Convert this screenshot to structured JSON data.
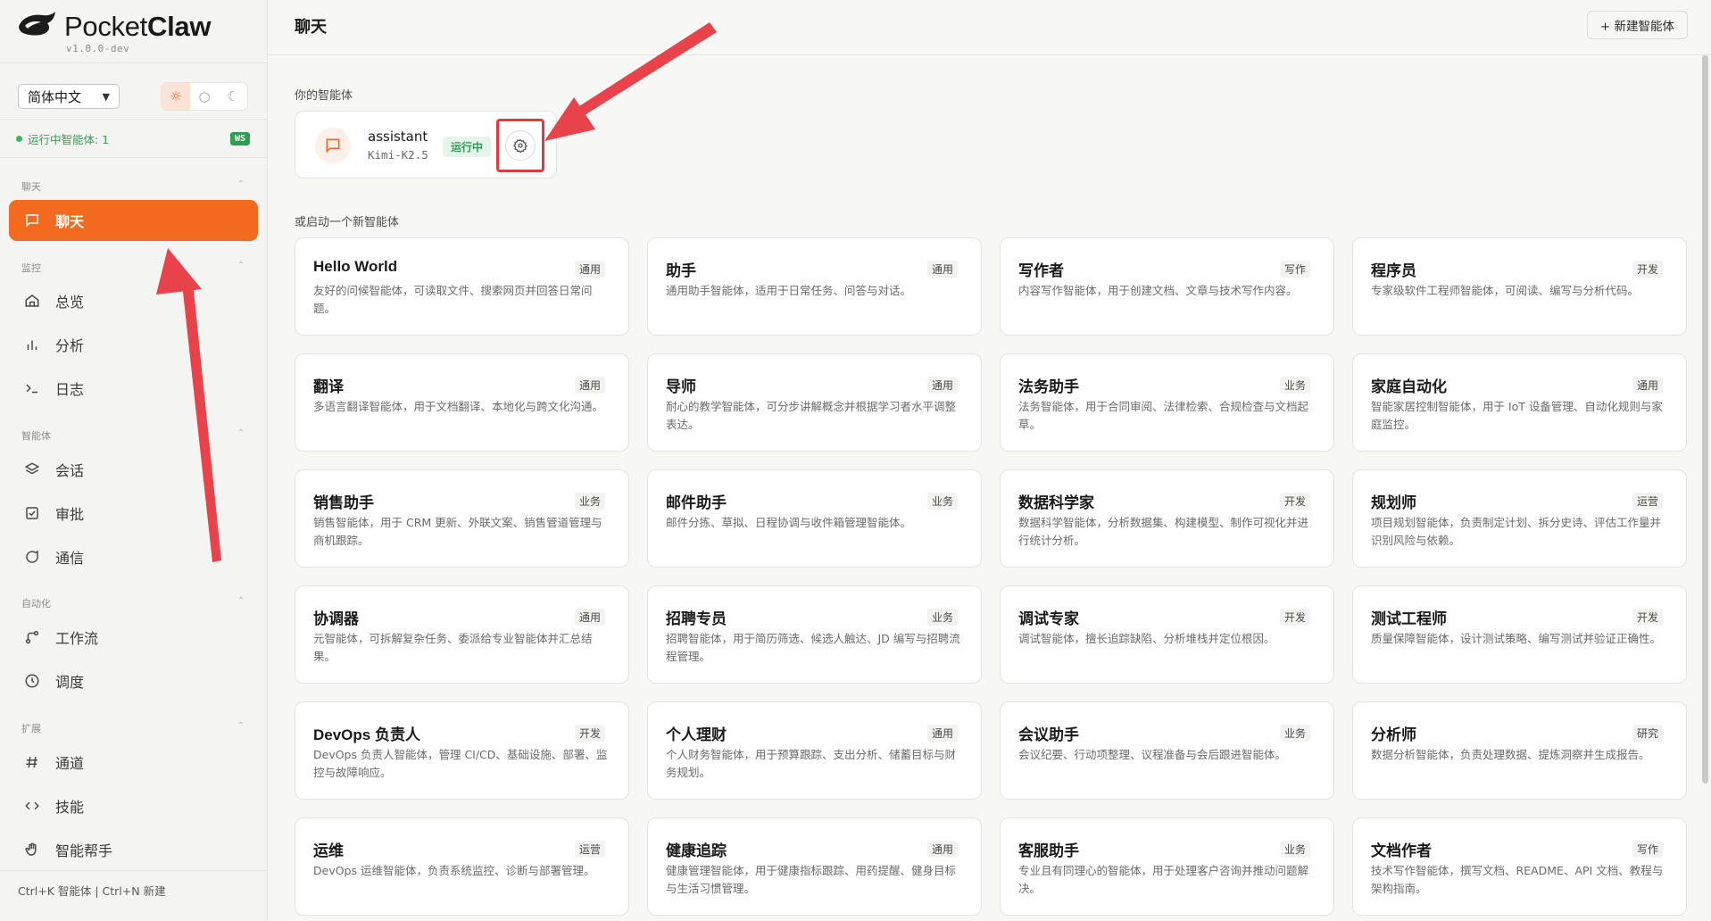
{
  "brand": {
    "name_light": "Pocket",
    "name_bold": "Claw",
    "version": "v1.0.0-dev"
  },
  "language": {
    "selected": "简体中文"
  },
  "theme": {
    "options": [
      "☼",
      "○",
      "☾"
    ],
    "active": "light"
  },
  "status": {
    "running_text": "运行中智能体: 1",
    "ws_badge": "WS"
  },
  "sidebar": {
    "sections": [
      {
        "label": "聊天",
        "items": [
          {
            "label": "聊天",
            "icon": "message-icon",
            "active": true
          }
        ]
      },
      {
        "label": "监控",
        "items": [
          {
            "label": "总览",
            "icon": "home-icon"
          },
          {
            "label": "分析",
            "icon": "bar-chart-icon"
          },
          {
            "label": "日志",
            "icon": "terminal-icon"
          }
        ]
      },
      {
        "label": "智能体",
        "items": [
          {
            "label": "会话",
            "icon": "layers-icon"
          },
          {
            "label": "审批",
            "icon": "checkbox-icon"
          },
          {
            "label": "通信",
            "icon": "chat-bubble-icon"
          }
        ]
      },
      {
        "label": "自动化",
        "items": [
          {
            "label": "工作流",
            "icon": "workflow-icon"
          },
          {
            "label": "调度",
            "icon": "clock-icon"
          }
        ]
      },
      {
        "label": "扩展",
        "items": [
          {
            "label": "通道",
            "icon": "hash-icon"
          },
          {
            "label": "技能",
            "icon": "code-icon"
          },
          {
            "label": "智能帮手",
            "icon": "hand-icon"
          }
        ]
      }
    ],
    "footer": "Ctrl+K 智能体 | Ctrl+N 新建"
  },
  "header": {
    "title": "聊天",
    "new_agent_label": "+ 新建智能体"
  },
  "my_agents": {
    "label": "你的智能体",
    "items": [
      {
        "name": "assistant",
        "model": "Kimi-K2.5",
        "status": "运行中"
      }
    ]
  },
  "templates": {
    "label": "或启动一个新智能体",
    "items": [
      {
        "name": "Hello World",
        "category": "通用",
        "desc": "友好的问候智能体，可读取文件、搜索网页并回答日常问题。"
      },
      {
        "name": "助手",
        "category": "通用",
        "desc": "通用助手智能体，适用于日常任务、问答与对话。"
      },
      {
        "name": "写作者",
        "category": "写作",
        "desc": "内容写作智能体，用于创建文档、文章与技术写作内容。"
      },
      {
        "name": "程序员",
        "category": "开发",
        "desc": "专家级软件工程师智能体，可阅读、编写与分析代码。"
      },
      {
        "name": "翻译",
        "category": "通用",
        "desc": "多语言翻译智能体，用于文档翻译、本地化与跨文化沟通。"
      },
      {
        "name": "导师",
        "category": "通用",
        "desc": "耐心的教学智能体，可分步讲解概念并根据学习者水平调整表达。"
      },
      {
        "name": "法务助手",
        "category": "业务",
        "desc": "法务智能体，用于合同审阅、法律检索、合规检查与文档起草。"
      },
      {
        "name": "家庭自动化",
        "category": "通用",
        "desc": "智能家居控制智能体，用于 IoT 设备管理、自动化规则与家庭监控。"
      },
      {
        "name": "销售助手",
        "category": "业务",
        "desc": "销售智能体，用于 CRM 更新、外联文案、销售管道管理与商机跟踪。"
      },
      {
        "name": "邮件助手",
        "category": "业务",
        "desc": "邮件分拣、草拟、日程协调与收件箱管理智能体。"
      },
      {
        "name": "数据科学家",
        "category": "开发",
        "desc": "数据科学智能体，分析数据集、构建模型、制作可视化并进行统计分析。"
      },
      {
        "name": "规划师",
        "category": "运营",
        "desc": "项目规划智能体，负责制定计划、拆分史诗、评估工作量并识别风险与依赖。"
      },
      {
        "name": "协调器",
        "category": "通用",
        "desc": "元智能体，可拆解复杂任务、委派给专业智能体并汇总结果。"
      },
      {
        "name": "招聘专员",
        "category": "业务",
        "desc": "招聘智能体，用于简历筛选、候选人触达、JD 编写与招聘流程管理。"
      },
      {
        "name": "调试专家",
        "category": "开发",
        "desc": "调试智能体，擅长追踪缺陷、分析堆栈并定位根因。"
      },
      {
        "name": "测试工程师",
        "category": "开发",
        "desc": "质量保障智能体，设计测试策略、编写测试并验证正确性。"
      },
      {
        "name": "DevOps 负责人",
        "category": "开发",
        "desc": "DevOps 负责人智能体，管理 CI/CD、基础设施、部署、监控与故障响应。"
      },
      {
        "name": "个人理财",
        "category": "通用",
        "desc": "个人财务智能体，用于预算跟踪、支出分析、储蓄目标与财务规划。"
      },
      {
        "name": "会议助手",
        "category": "业务",
        "desc": "会议纪要、行动项整理、议程准备与会后跟进智能体。"
      },
      {
        "name": "分析师",
        "category": "研究",
        "desc": "数据分析智能体，负责处理数据、提炼洞察并生成报告。"
      },
      {
        "name": "运维",
        "category": "运营",
        "desc": "DevOps 运维智能体，负责系统监控、诊断与部署管理。"
      },
      {
        "name": "健康追踪",
        "category": "通用",
        "desc": "健康管理智能体，用于健康指标跟踪、用药提醒、健身目标与生活习惯管理。"
      },
      {
        "name": "客服助手",
        "category": "业务",
        "desc": "专业且有同理心的智能体，用于处理客户咨询并推动问题解决。"
      },
      {
        "name": "文档作者",
        "category": "写作",
        "desc": "技术写作智能体，撰写文档、README、API 文档、教程与架构指南。"
      }
    ]
  },
  "colors": {
    "accent": "#f36a1f",
    "annotation": "#e8434a",
    "running": "#2e9e4f"
  }
}
